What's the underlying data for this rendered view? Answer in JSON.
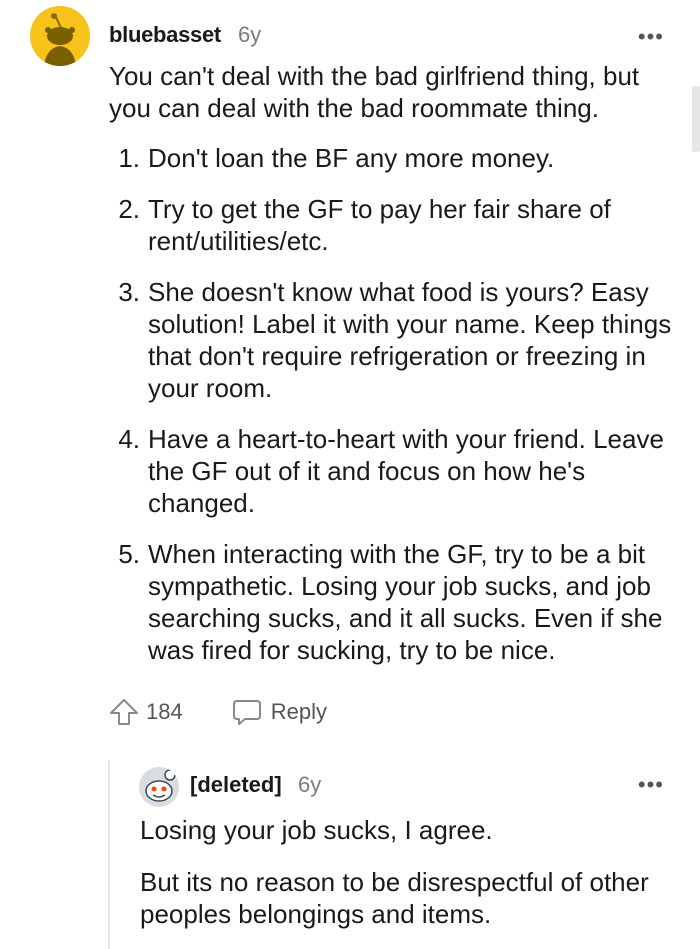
{
  "comment": {
    "username": "bluebasset",
    "age": "6y",
    "more": "•••",
    "text": "You can't deal with the bad girlfriend thing, but you can deal with the bad roommate thing.",
    "list": [
      {
        "num": "1.",
        "text": "Don't loan the BF any more money."
      },
      {
        "num": "2.",
        "text": "Try to get the GF to pay her fair share of rent/utilities/etc."
      },
      {
        "num": "3.",
        "text": "She doesn't know what food is yours? Easy solution! Label it with your name. Keep things that don't require refrigeration or freezing in your room."
      },
      {
        "num": "4.",
        "text": "Have a heart-to-heart with your friend. Leave the GF out of it and focus on how he's changed."
      },
      {
        "num": "5.",
        "text": "When interacting with the GF, try to be a bit sympathetic. Losing your job sucks, and job searching sucks, and it all sucks. Even if she was fired for sucking, try to be nice."
      }
    ],
    "votes": "184",
    "reply_label": "Reply",
    "avatar_color": "#f7c31b"
  },
  "reply": {
    "username": "[deleted]",
    "age": "6y",
    "more": "•••",
    "paragraphs": [
      "Losing your job sucks, I agree.",
      "But its no reason to be disrespectful of other peoples belongings and items."
    ]
  }
}
